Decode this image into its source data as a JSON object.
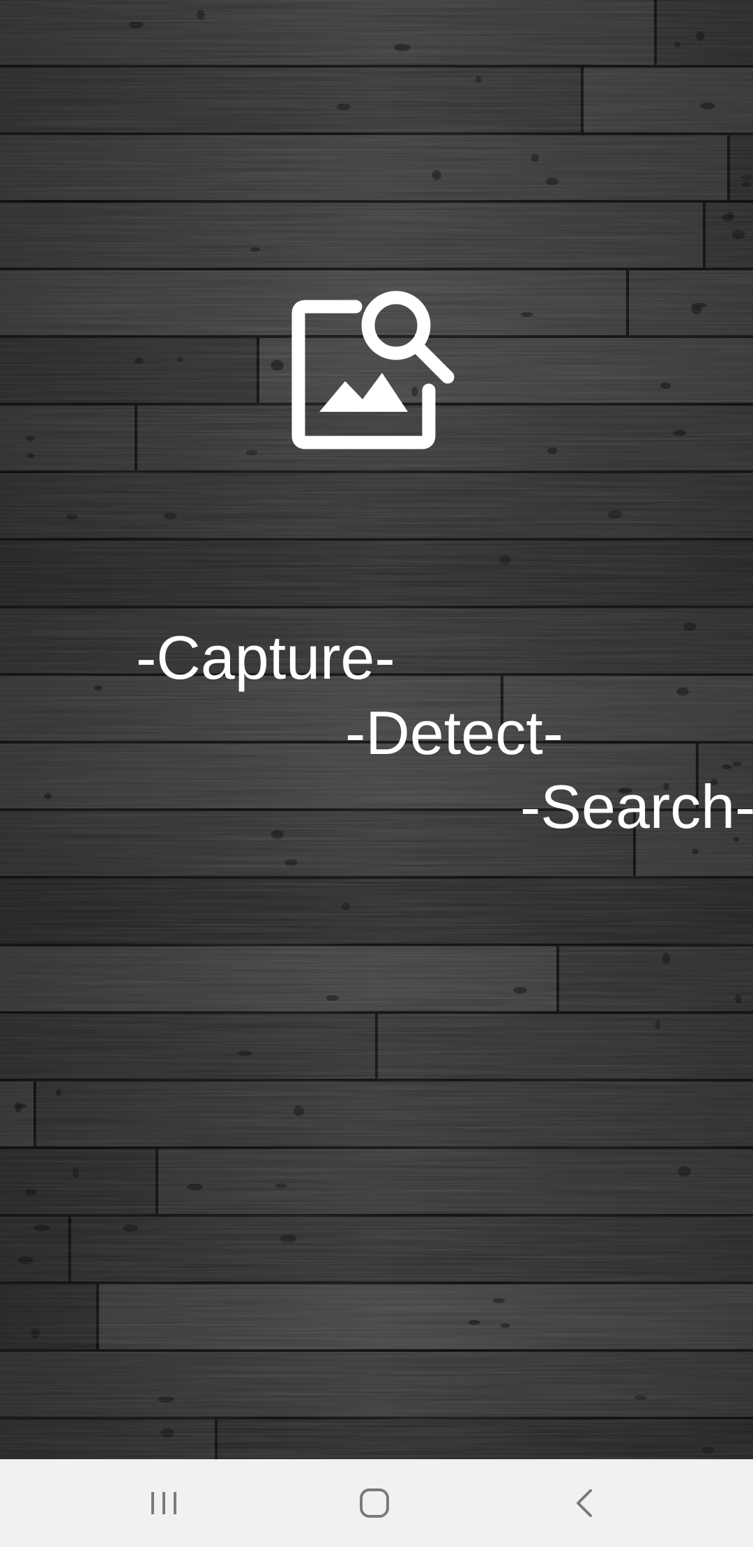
{
  "splash": {
    "taglines": [
      "-Capture-",
      "-Detect-",
      "-Search-"
    ],
    "logo_icon": "image-search-icon",
    "text_color": "#ffffff",
    "background": "dark-wood-planks"
  },
  "navbar": {
    "background": "#f1f1f1",
    "icon_color": "#7a7a7a",
    "buttons": [
      "recents-icon",
      "home-icon",
      "back-icon"
    ]
  }
}
